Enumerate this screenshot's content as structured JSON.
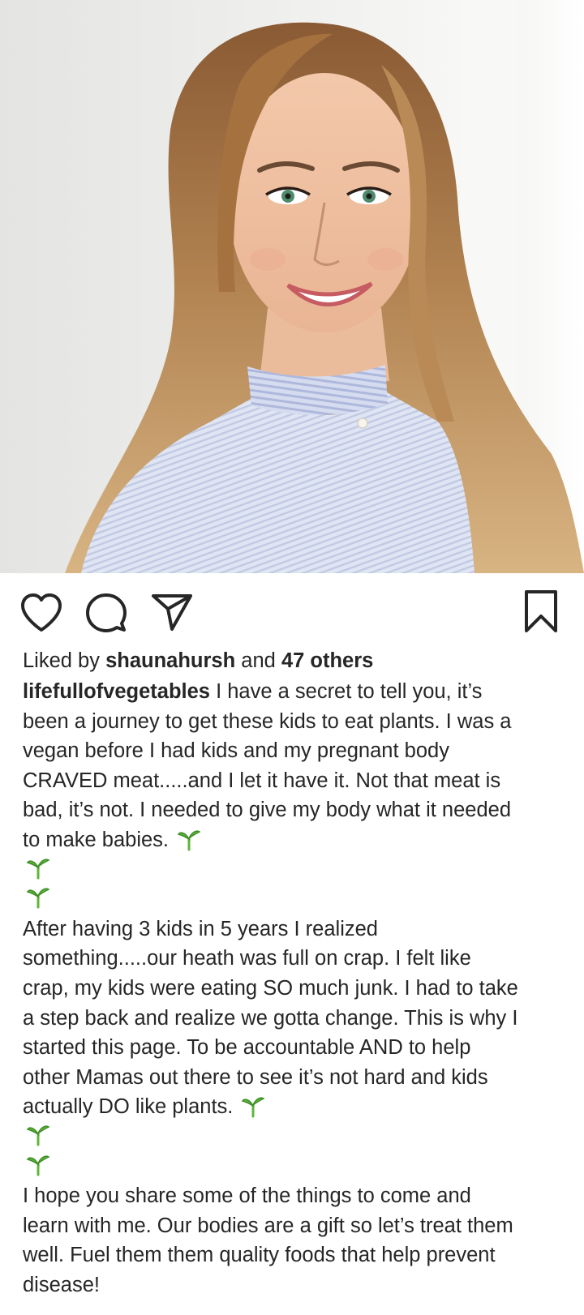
{
  "post": {
    "photo_alt": "Smiling woman with long hair wearing a striped choker",
    "likes": {
      "prefix": "Liked by",
      "user": "shaunahursh",
      "conjunction": "and",
      "others": "47 others"
    },
    "caption": {
      "username": "lifefullofvegetables",
      "paragraph1": [
        " I have a secret to tell you, it’s",
        "been a journey to get these kids to eat plants. I was a",
        "vegan before I had kids and my pregnant body",
        "CRAVED meat.....and I let it have it.  Not that meat is",
        "bad, it’s not. I needed to give my body what it needed",
        "to make babies."
      ],
      "paragraph2": [
        "After having 3 kids in 5 years I realized",
        "something.....our heath was full on crap. I felt like",
        "crap, my kids were eating SO much junk. I had to take",
        "a step back and realize we gotta change. This is why I",
        "started this page. To be  accountable AND to help",
        "other Mamas out there to see it’s not hard and kids",
        "actually DO like plants."
      ],
      "paragraph3": [
        "I hope you share some of the things to come and",
        "learn with me. Our bodies are a gift so let’s treat them",
        "well. Fuel them them quality foods that help prevent",
        "disease!"
      ]
    },
    "icons": {
      "like": "heart-icon",
      "comment": "comment-icon",
      "share": "send-icon",
      "save": "bookmark-icon",
      "emoji": "seedling-emoji"
    },
    "colors": {
      "text": "#262626",
      "sprout": "#5fb63a"
    }
  }
}
